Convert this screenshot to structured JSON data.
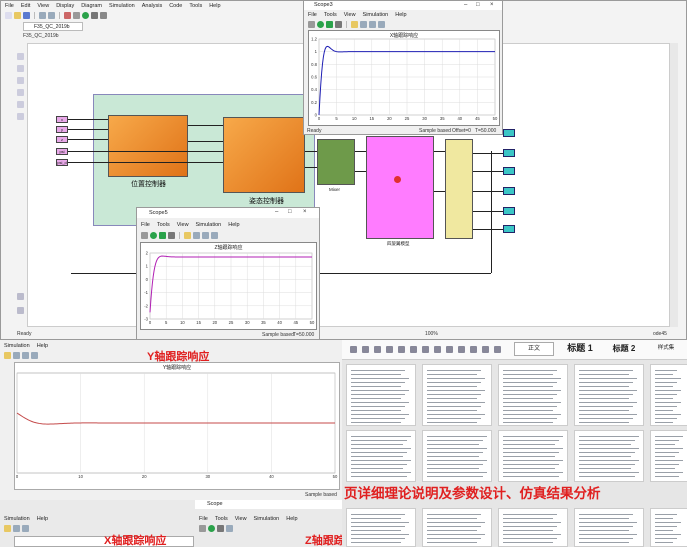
{
  "main": {
    "menu": [
      "File",
      "Edit",
      "View",
      "Display",
      "Diagram",
      "Simulation",
      "Analysis",
      "Code",
      "Tools",
      "Help"
    ],
    "tab": "F35_QC_2019b",
    "breadcrumb": "F35_QC_2019b",
    "status_left": "Ready",
    "status_zoom": "100%",
    "status_solver": "ode45",
    "blocks": {
      "position_controller": "位置控制器",
      "attitude_controller": "姿态控制器",
      "mixer_label": "Mixer",
      "quad_model": "四旋翼模型",
      "inports": [
        "x",
        "y",
        "z",
        "psi",
        "psi_d"
      ]
    }
  },
  "scope_x": {
    "title": "Scope3",
    "menu": [
      "File",
      "Tools",
      "View",
      "Simulation",
      "Help"
    ],
    "plot_title": "X轴跟踪响应",
    "yticks": [
      "1.2",
      "1",
      "0.8",
      "0.6",
      "0.4",
      "0.2",
      "0"
    ],
    "xticks": [
      "0",
      "5",
      "10",
      "15",
      "20",
      "25",
      "30",
      "35",
      "40",
      "45",
      "50"
    ],
    "status_left": "Ready",
    "status_mid": "Sample based",
    "status_offset": "Offset=0",
    "status_time": "T=50.000"
  },
  "scope_z": {
    "title": "Scope5",
    "menu": [
      "File",
      "Tools",
      "View",
      "Simulation",
      "Help"
    ],
    "plot_title": "Z轴跟踪响应",
    "yticks": [
      "2",
      "1",
      "0",
      "-1",
      "-2",
      "-3"
    ],
    "xticks": [
      "0",
      "5",
      "10",
      "15",
      "20",
      "25",
      "30",
      "35",
      "40",
      "45",
      "50"
    ],
    "status_mid": "Sample based",
    "status_time": "T=50.000"
  },
  "scope_y": {
    "menu": [
      "Simulation",
      "Help"
    ],
    "overlay_label": "Y轴跟踪响应",
    "plot_title": "Y轴跟踪响应",
    "xticks": [
      "0",
      "10",
      "20",
      "30",
      "40",
      "50"
    ],
    "status_right": "Sample based"
  },
  "bottom": {
    "menu_left": [
      "Simulation",
      "Help"
    ],
    "overlay_x": "X轴跟踪响应",
    "scope_title": "Scope",
    "menu_right": [
      "File",
      "Tools",
      "View",
      "Simulation",
      "Help"
    ],
    "overlay_z": "Z轴跟踪"
  },
  "document": {
    "style_normal": "正文",
    "style_h1": "标题 1",
    "style_h2": "标题 2",
    "style_gallery": "样式集",
    "overlay_caption": "页详细理论说明及参数设计、仿真结果分析"
  },
  "colors": {
    "accent_orange": "#f08a24",
    "mixer_green": "#6e9a4a",
    "model_magenta": "#ff7cff",
    "scope_line": "#1f1fb4",
    "z_line": "#b11fb4",
    "y_line": "#c44a4a",
    "overlay_red": "#e02020"
  }
}
